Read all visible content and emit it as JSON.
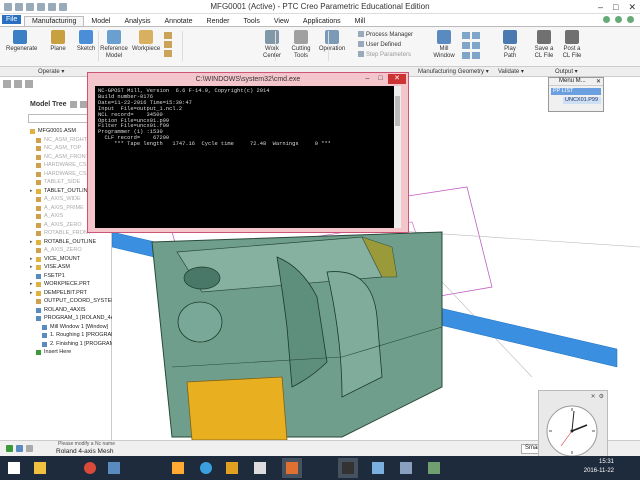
{
  "window": {
    "title": "MFG0001 (Active) - PTC Creo Parametric Educational Edition",
    "controls": [
      "–",
      "□",
      "✕"
    ]
  },
  "tabs": [
    "File",
    "Manufacturing",
    "Model",
    "Analysis",
    "Annotate",
    "Render",
    "Tools",
    "View",
    "Applications",
    "Mill"
  ],
  "active_tab": "Manufacturing",
  "ribbon": {
    "buttons": [
      {
        "label": "Regenerate",
        "icon": "regenerate-icon",
        "color": "#3b7fc4"
      },
      {
        "label": "Plane",
        "icon": "plane-icon",
        "color": "#c8a040"
      },
      {
        "label": "Sketch",
        "icon": "sketch-icon",
        "color": "#4a8ed8"
      },
      {
        "label": "Reference\nModel",
        "icon": "reference-model-icon",
        "color": "#6aa0d0"
      },
      {
        "label": "Workpiece",
        "icon": "workpiece-icon",
        "color": "#d8b060"
      },
      {
        "label": "Work\nCenter",
        "icon": "work-center-icon",
        "color": "#8098a8"
      },
      {
        "label": "Cutting\nTools",
        "icon": "cutting-tools-icon",
        "color": "#a0a0a0"
      },
      {
        "label": "Operation",
        "icon": "operation-icon",
        "color": "#7a9ab8"
      },
      {
        "label": "Mill\nWindow",
        "icon": "mill-window-icon",
        "color": "#5a8bc0"
      },
      {
        "label": "Play\nPath",
        "icon": "play-path-icon",
        "color": "#4a7ab0"
      },
      {
        "label": "Save a\nCL File",
        "icon": "save-cl-file-icon",
        "color": "#707070"
      },
      {
        "label": "Post a\nCL File",
        "icon": "post-cl-file-icon",
        "color": "#707070"
      }
    ],
    "small_items": [
      "Process Manager",
      "User Defined",
      "Step Parameters"
    ]
  },
  "groups": [
    "Operate ▾",
    "Manufacturing Geometry ▾",
    "Validate ▾",
    "Output ▾"
  ],
  "model_tree": {
    "label": "Model Tree",
    "rows": [
      {
        "text": "MFG0001.ASM",
        "dim": false,
        "expand": false,
        "icon": "assembly-icon",
        "color": "#e0b040",
        "indent": 1
      },
      {
        "text": "NC_ASM_RIGHT",
        "dim": true,
        "expand": false,
        "icon": "datum-plane-icon",
        "color": "#cfa050",
        "indent": 2
      },
      {
        "text": "NC_ASM_TOP",
        "dim": true,
        "expand": false,
        "icon": "datum-plane-icon",
        "color": "#cfa050",
        "indent": 2
      },
      {
        "text": "NC_ASM_FRONT",
        "dim": true,
        "expand": false,
        "icon": "datum-plane-icon",
        "color": "#cfa050",
        "indent": 2
      },
      {
        "text": "HARDWARE_CSYS",
        "dim": true,
        "expand": false,
        "icon": "csys-icon",
        "color": "#cfa050",
        "indent": 2
      },
      {
        "text": "HARDWARE_CSYS",
        "dim": true,
        "expand": false,
        "icon": "csys-icon",
        "color": "#cfa050",
        "indent": 2
      },
      {
        "text": "TABLET_SIDE",
        "dim": true,
        "expand": false,
        "icon": "datum-plane-icon",
        "color": "#cfa050",
        "indent": 2
      },
      {
        "text": "TABLET_OUTLINE",
        "dim": false,
        "expand": true,
        "icon": "feature-icon",
        "color": "#e0b040",
        "indent": 2
      },
      {
        "text": "A_AXIS_WIDE",
        "dim": true,
        "expand": false,
        "icon": "axis-icon",
        "color": "#cfa050",
        "indent": 2
      },
      {
        "text": "A_AXIS_PRIME",
        "dim": true,
        "expand": false,
        "icon": "axis-icon",
        "color": "#cfa050",
        "indent": 2
      },
      {
        "text": "A_AXIS",
        "dim": true,
        "expand": false,
        "icon": "axis-icon",
        "color": "#cfa050",
        "indent": 2
      },
      {
        "text": "A_AXIS_ZERO",
        "dim": true,
        "expand": false,
        "icon": "axis-icon",
        "color": "#cfa050",
        "indent": 2
      },
      {
        "text": "ROTABLE_FRONT",
        "dim": true,
        "expand": false,
        "icon": "datum-plane-icon",
        "color": "#cfa050",
        "indent": 2
      },
      {
        "text": "ROTABLE_OUTLINE",
        "dim": false,
        "expand": true,
        "icon": "feature-icon",
        "color": "#e0b040",
        "indent": 2
      },
      {
        "text": "A_AXIS_ZERO",
        "dim": true,
        "expand": false,
        "icon": "axis-icon",
        "color": "#cfa050",
        "indent": 2
      },
      {
        "text": "VICE_MOUNT",
        "dim": false,
        "expand": true,
        "icon": "part-icon",
        "color": "#e0b040",
        "indent": 2
      },
      {
        "text": "VISE.ASM",
        "dim": false,
        "expand": true,
        "icon": "assembly-icon",
        "color": "#e0b040",
        "indent": 2
      },
      {
        "text": "FSETP1",
        "dim": false,
        "expand": false,
        "icon": "fixture-icon",
        "color": "#5a8bc0",
        "indent": 2
      },
      {
        "text": "WORKPIECE.PRT",
        "dim": false,
        "expand": true,
        "icon": "part-icon",
        "color": "#e0b040",
        "indent": 2
      },
      {
        "text": "DEMPELBIT.PRT",
        "dim": false,
        "expand": true,
        "icon": "part-icon",
        "color": "#e0b040",
        "indent": 2
      },
      {
        "text": "OUTPUT_COORD_SYSTEM",
        "dim": false,
        "expand": false,
        "icon": "csys-icon",
        "color": "#cfa050",
        "indent": 2
      },
      {
        "text": "ROLAND_4AXIS",
        "dim": false,
        "expand": false,
        "icon": "work-center-icon",
        "color": "#5a8bc0",
        "indent": 2
      },
      {
        "text": "PROGRAM_1 [ROLAND_4AXIS]",
        "dim": false,
        "expand": false,
        "icon": "program-icon",
        "color": "#5a8bc0",
        "indent": 2
      },
      {
        "text": "Mill Window 1 [Window]",
        "dim": false,
        "expand": false,
        "icon": "mill-window-icon",
        "color": "#5a8bc0",
        "indent": 3
      },
      {
        "text": "1. Roughing 1 [PROGRAM_1]",
        "dim": false,
        "expand": false,
        "icon": "sequence-icon",
        "color": "#5a8bc0",
        "indent": 3
      },
      {
        "text": "2. Finishing 1 [PROGRAM_1]",
        "dim": false,
        "expand": false,
        "icon": "sequence-icon",
        "color": "#5a8bc0",
        "indent": 3
      },
      {
        "text": "Insert Here",
        "dim": false,
        "expand": false,
        "icon": "insert-here-icon",
        "color": "#3a9a3a",
        "indent": 2
      }
    ]
  },
  "cmd_window": {
    "title": "C:\\WINDOWS\\system32\\cmd.exe",
    "lines": [
      "NC-GPOST Mill, Version  6.6 F-14.0, Copyright(c) 2014",
      "Build number-0176",
      "Date=11-22-2016 Time=15:30:47",
      "Input  File=output_1.ncl.2",
      "NCL record=    34500",
      "Option File=uncx01.p99",
      "Filter File=uncx01.f99",
      "Programmer (1) :1530",
      "  CLF record=    67200",
      "     *** Tape length   1747.16  Cycle time     72.48  Warnings     0 ***"
    ]
  },
  "menu_manager": {
    "title": "Menu M...",
    "items": [
      "PP LIST",
      "UNCX01.P99"
    ]
  },
  "status": {
    "message": "Please modify a Nc name",
    "machine": "Roland 4-axis Mesh",
    "smart_filter": "Smart"
  },
  "taskbar": {
    "time": "15:31",
    "date": "2016-11-22",
    "apps": [
      {
        "name": "windows-start-icon",
        "color": "#ffffff"
      },
      {
        "name": "file-explorer-icon",
        "color": "#f0c040"
      },
      {
        "name": "chrome-icon",
        "color": "#d94a38"
      },
      {
        "name": "vlc-app-icon",
        "color": "#5a8bc0"
      },
      {
        "name": "media-player-icon",
        "color": "#ffaa33"
      },
      {
        "name": "teamviewer-icon",
        "color": "#3aa0e0"
      },
      {
        "name": "paint-app-icon",
        "color": "#e0a020"
      },
      {
        "name": "inkscape-icon",
        "color": "#dddddd"
      },
      {
        "name": "creo-app-icon",
        "color": "#e07030"
      },
      {
        "name": "cmd-app-icon",
        "color": "#333333"
      },
      {
        "name": "notepad-app-icon",
        "color": "#7ab0e0"
      },
      {
        "name": "calculator-app-icon",
        "color": "#8aa0c0"
      },
      {
        "name": "misc-app-icon",
        "color": "#70a070"
      }
    ]
  },
  "colors": {
    "model_green": "#6f9f8c",
    "axis_blue": "#3a8fe0",
    "workpiece_yellow": "#e8b020",
    "magenta_outline": "#c060c0"
  }
}
